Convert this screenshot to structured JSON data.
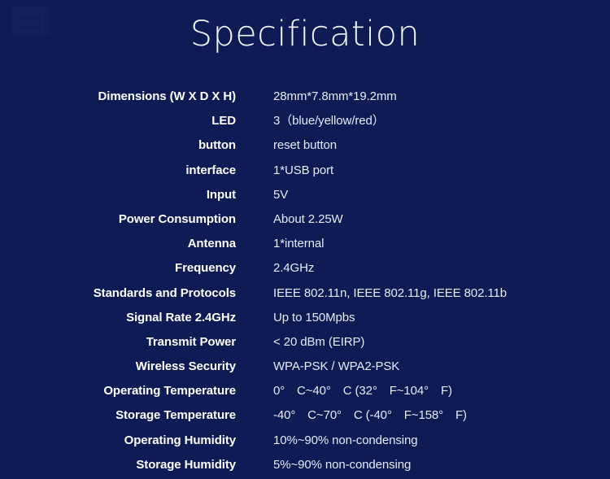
{
  "page": {
    "title": "Specification",
    "background_color": "#0e1b55",
    "label_color": "#ffffff",
    "value_color": "#e6ebf7"
  },
  "spec_table": {
    "rows": [
      {
        "label": "Dimensions (W X D X H)",
        "value": "28mm*7.8mm*19.2mm"
      },
      {
        "label": "LED",
        "value": "3（blue/yellow/red）"
      },
      {
        "label": "button",
        "value": "reset button"
      },
      {
        "label": "interface",
        "value": "1*USB port"
      },
      {
        "label": "Input",
        "value": "5V"
      },
      {
        "label": "Power Consumption",
        "value": "About 2.25W"
      },
      {
        "label": "Antenna",
        "value": "1*internal"
      },
      {
        "label": "Frequency",
        "value": "2.4GHz"
      },
      {
        "label": "Standards and Protocols",
        "value": "IEEE 802.11n, IEEE 802.11g, IEEE 802.11b"
      },
      {
        "label": "Signal Rate 2.4GHz",
        "value": "Up to 150Mpbs"
      },
      {
        "label": "Transmit Power",
        "value": "< 20 dBm (EIRP)"
      },
      {
        "label": "Wireless Security",
        "value": "WPA-PSK / WPA2-PSK"
      },
      {
        "label": "Operating Temperature",
        "value": "0°　C~40°　C (32°　F~104°　F)"
      },
      {
        "label": "Storage Temperature",
        "value": "-40°　C~70°　C (-40°　F~158°　F)"
      },
      {
        "label": "Operating Humidity",
        "value": "10%~90% non-condensing"
      },
      {
        "label": "Storage Humidity",
        "value": "5%~90% non-condensing"
      }
    ]
  }
}
